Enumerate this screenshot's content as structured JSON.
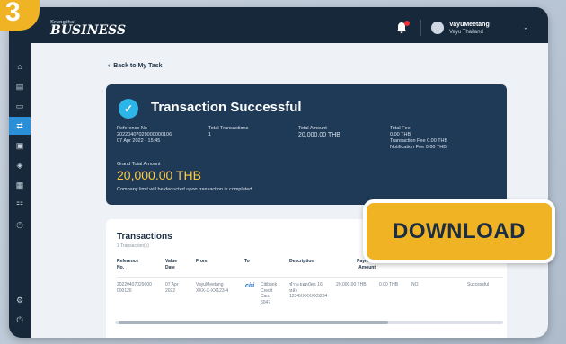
{
  "step_number": "3",
  "brand": {
    "small": "Krungthai",
    "name": "BUSINESS"
  },
  "user": {
    "name": "VayuMeetang",
    "org": "Vayu Thailand"
  },
  "nav": {
    "back_label": "Back to My Task"
  },
  "success": {
    "title": "Transaction Successful",
    "reference_label": "Reference No",
    "reference_value": "20220407029000000106\n07 Apr 2022 - 15:45",
    "total_tx_label": "Total Transactions",
    "total_tx_value": "1",
    "total_amount_label": "Total Amount",
    "total_amount_value": "20,000.00 THB",
    "total_fee_label": "Total Fee",
    "total_fee_value": "0.00 THB\nTransaction Fee 0.00 THB\nNotification Fee 0.00 THB",
    "grand_total_label": "Grand Total Amount",
    "grand_total_value": "20,000.00 THB",
    "limit_note": "Company limit will be deducted upon transaction is completed"
  },
  "transactions": {
    "title": "Transactions",
    "count": "1 Transaction(s)",
    "columns": [
      "Reference\nNo.",
      "Value\nDate",
      "From",
      "To",
      "Description",
      "Payment\nAmount"
    ],
    "row": {
      "reference": "20220407029000\n000126",
      "value_date": "07 Apr\n2022",
      "from": "VayuMeetang\nXXX-X-XX123-4",
      "bank_logo": "citi",
      "to": "Citibank\nCredit\nCard\n6047",
      "description": "ชำระยอดบัตร 16\nหลัก\n1234XXXXXX5234",
      "amount": "20,000.00 THB",
      "fee": "0.00 THB",
      "flag": "NO",
      "status": "Successful"
    }
  },
  "download_label": "DOWNLOAD",
  "colors": {
    "accent": "#f0b323",
    "navy": "#1f3a57",
    "active": "#2a8fd7"
  }
}
